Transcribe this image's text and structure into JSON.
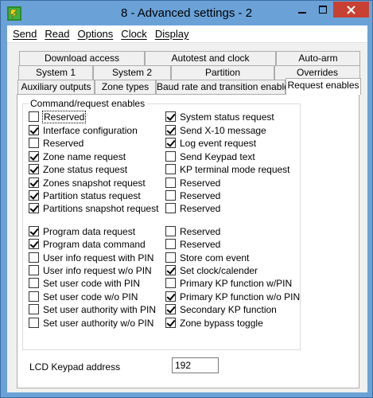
{
  "window": {
    "title": "8 - Advanced settings - 2"
  },
  "menu": [
    "Send",
    "Read",
    "Options",
    "Clock",
    "Display"
  ],
  "tabs": {
    "row1": [
      "Download access",
      "Autotest and clock",
      "Auto-arm"
    ],
    "row2": [
      "System 1",
      "System 2",
      "Partition",
      "Overrides"
    ],
    "row3": [
      "Auxiliary outputs",
      "Zone types",
      "Baud rate and transition enable",
      "Request enables"
    ],
    "active": "Request enables"
  },
  "group": {
    "title": "Command/request enables",
    "left": [
      {
        "label": "Reserved",
        "checked": false
      },
      {
        "label": "Interface configuration",
        "checked": true
      },
      {
        "label": "Reserved",
        "checked": false
      },
      {
        "label": "Zone name request",
        "checked": true
      },
      {
        "label": "Zone status request",
        "checked": true
      },
      {
        "label": "Zones snapshot request",
        "checked": true
      },
      {
        "label": "Partition status request",
        "checked": true
      },
      {
        "label": "Partitions snapshot request",
        "checked": true
      },
      {
        "label": "Program data request",
        "checked": true
      },
      {
        "label": "Program data command",
        "checked": true
      },
      {
        "label": "User info request with PIN",
        "checked": false
      },
      {
        "label": "User info request w/o PIN",
        "checked": false
      },
      {
        "label": "Set user code with PIN",
        "checked": false
      },
      {
        "label": "Set user code w/o PIN",
        "checked": false
      },
      {
        "label": "Set user authority with PIN",
        "checked": false
      },
      {
        "label": "Set user authority w/o PIN",
        "checked": false
      }
    ],
    "right": [
      {
        "label": "System status request",
        "checked": true
      },
      {
        "label": "Send X-10 message",
        "checked": true
      },
      {
        "label": "Log event request",
        "checked": true
      },
      {
        "label": "Send Keypad text",
        "checked": false
      },
      {
        "label": "KP terminal mode request",
        "checked": false
      },
      {
        "label": "Reserved",
        "checked": false
      },
      {
        "label": "Reserved",
        "checked": false
      },
      {
        "label": "Reserved",
        "checked": false
      },
      {
        "label": "Reserved",
        "checked": false
      },
      {
        "label": "Reserved",
        "checked": false
      },
      {
        "label": "Store com event",
        "checked": false
      },
      {
        "label": "Set clock/calender",
        "checked": true
      },
      {
        "label": "Primary KP function w/PIN",
        "checked": false
      },
      {
        "label": "Primary KP function w/o PIN",
        "checked": true
      },
      {
        "label": "Secondary  KP function",
        "checked": true
      },
      {
        "label": "Zone bypass toggle",
        "checked": true
      }
    ]
  },
  "lcd": {
    "label": "LCD Keypad address",
    "value": "192"
  },
  "colors": {
    "title_bar": "#6aa2d8",
    "close_button": "#c84031",
    "panel": "#ffffff",
    "dialog": "#f0f0f0"
  }
}
